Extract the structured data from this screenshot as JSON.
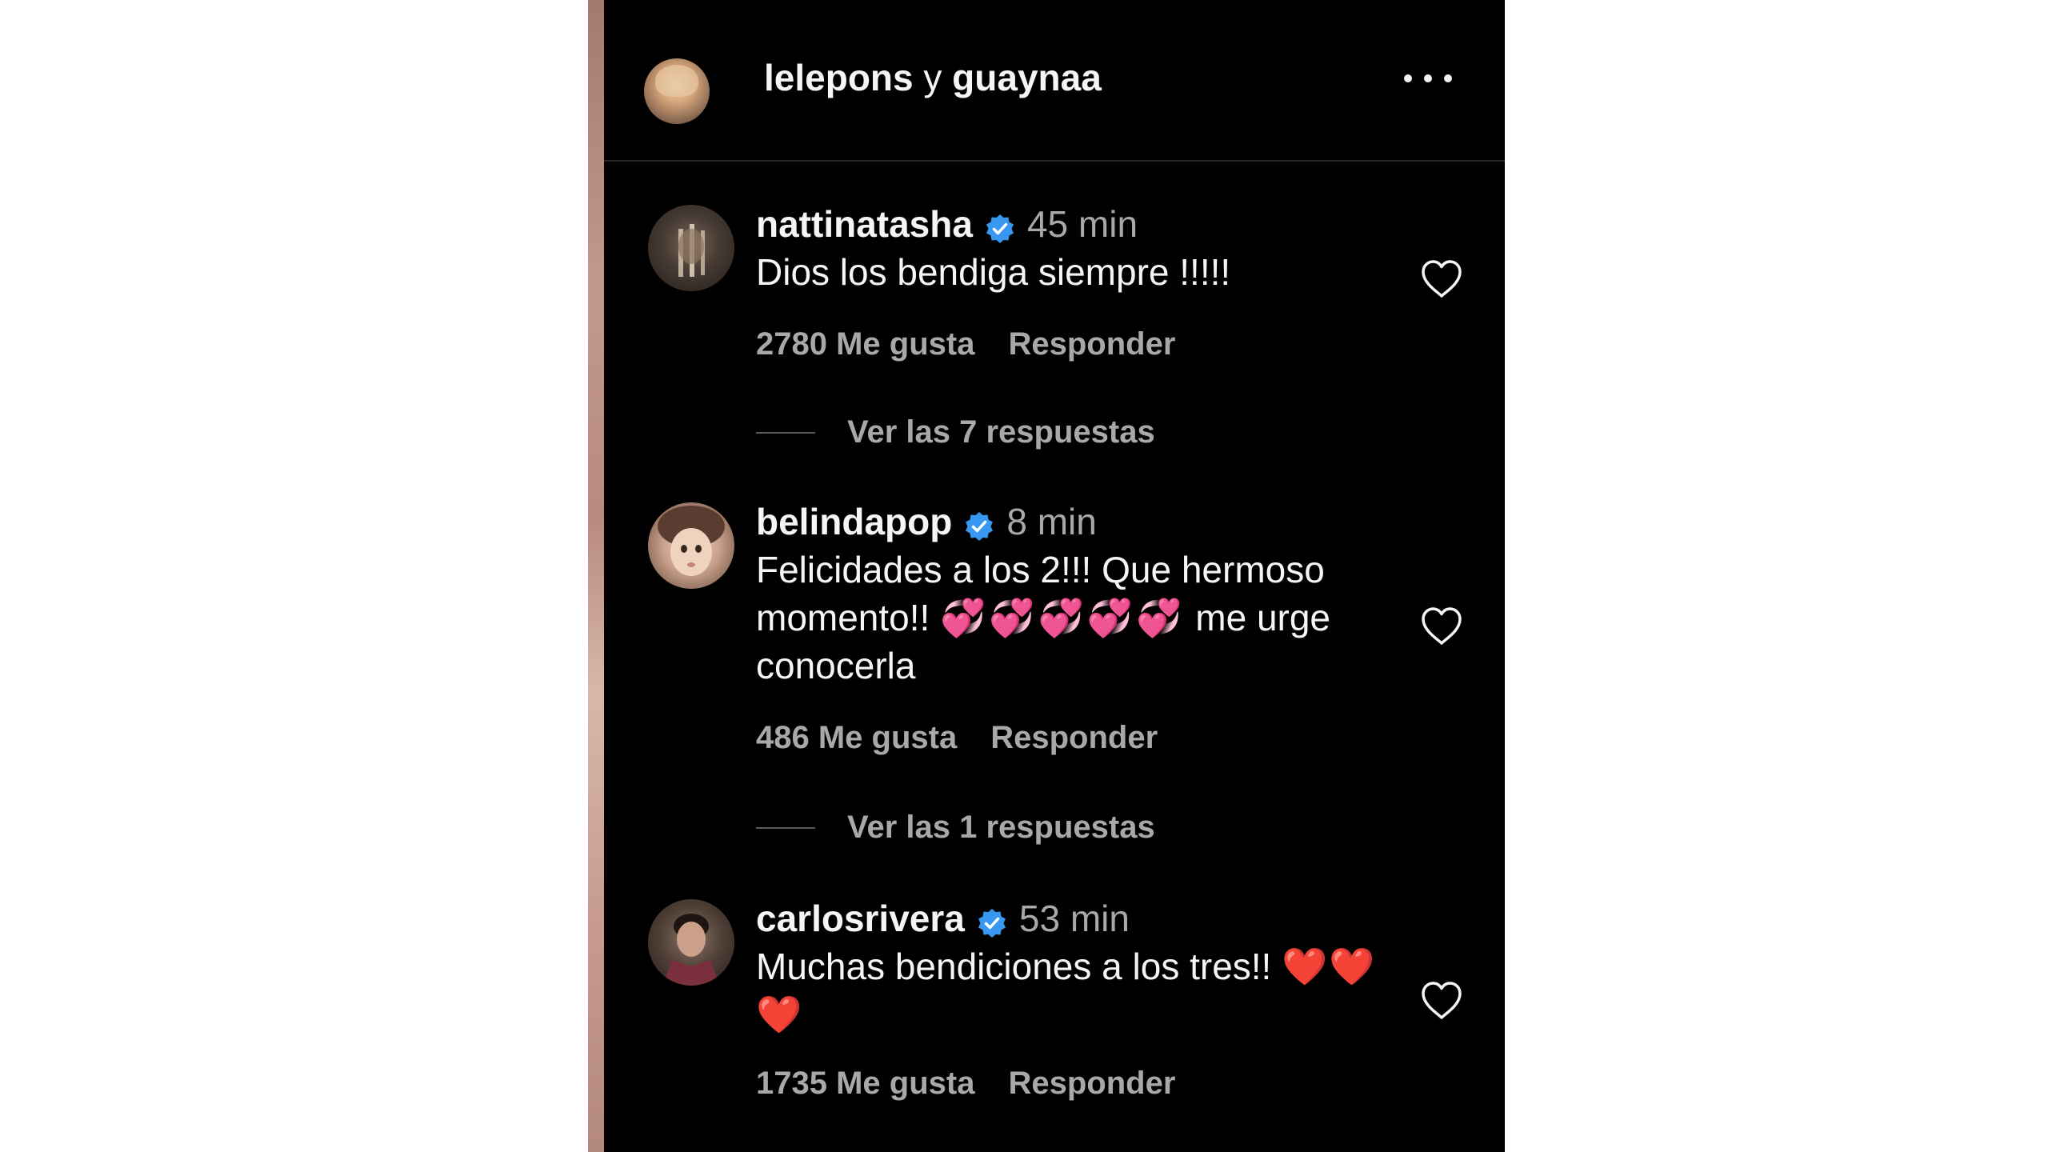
{
  "post": {
    "header_user1": "lelepons",
    "header_conj": "y",
    "header_user2": "guaynaa"
  },
  "icons": {
    "more": "more-options-icon",
    "verified": "verified-badge-icon",
    "like": "heart-outline-icon"
  },
  "colors": {
    "background": "#000000",
    "verified_blue": "#3897f0",
    "muted_text": "#a8a8a8",
    "primary_text": "#f5f5f5"
  },
  "comments": [
    {
      "username": "nattinatasha",
      "time": "45 min",
      "text_lines": [
        "Dios los bendiga siempre !!!!!"
      ],
      "likes": "2780 Me gusta",
      "reply": "Responder",
      "view_replies": "Ver las 7 respuestas"
    },
    {
      "username": "belindapop",
      "time": "8 min",
      "text_lines": [
        "Felicidades a los 2!!! Que hermoso",
        "momento!!",
        "💞💞💞💞💞",
        "me urge",
        "conocerla"
      ],
      "likes": "486 Me gusta",
      "reply": "Responder",
      "view_replies": "Ver las 1 respuestas"
    },
    {
      "username": "carlosrivera",
      "time": "53 min",
      "text_lines": [
        "Muchas bendiciones a los tres!!",
        "❤️❤️",
        "❤️"
      ],
      "likes": "1735 Me gusta",
      "reply": "Responder"
    }
  ]
}
